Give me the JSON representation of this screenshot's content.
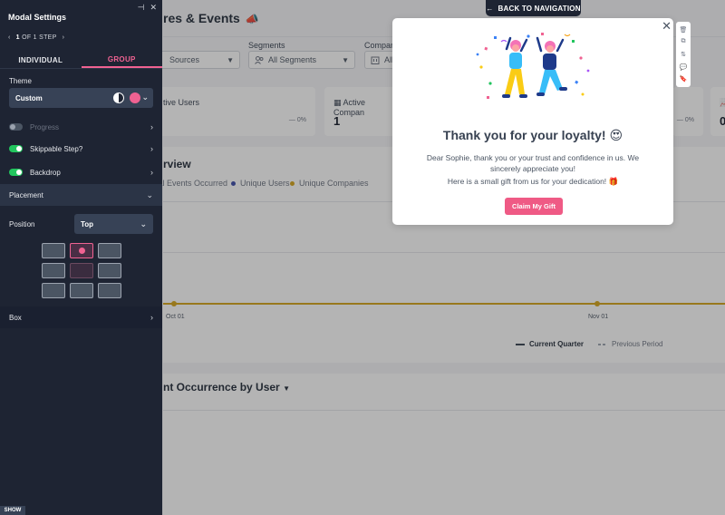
{
  "dashboard": {
    "title": "res & Events",
    "filters": [
      {
        "label": "",
        "value": "Sources"
      },
      {
        "label": "Segments",
        "value": "All Segments"
      },
      {
        "label": "Company",
        "value": "All"
      }
    ],
    "cards": [
      {
        "label": "tive Users",
        "value": "",
        "pct": "0%"
      },
      {
        "label": "Active Compan",
        "value": "1",
        "pct": ""
      },
      {
        "label": "",
        "value": "",
        "pct": "0%"
      },
      {
        "label": "",
        "value": "0",
        "pct": ""
      }
    ],
    "overview": {
      "title": "rview",
      "legend": [
        {
          "label": "tal Events Occurred",
          "color": "#c7c7d0"
        },
        {
          "label": "Unique Users",
          "color": "#3b4aa8"
        },
        {
          "label": "Unique Companies",
          "color": "#d4a417"
        }
      ],
      "bottom_legend": {
        "current": "Current Quarter",
        "previous": "Previous Period"
      }
    },
    "chart_data": {
      "type": "line",
      "x": [
        "Oct 01",
        "Nov 01"
      ],
      "series": [
        {
          "name": "Unique Companies",
          "values": [
            0,
            0
          ]
        }
      ]
    },
    "occurrence": {
      "title": "nt Occurrence by User"
    }
  },
  "back_nav": {
    "label": "BACK TO NAVIGATION"
  },
  "panel": {
    "title": "Modal Settings",
    "step": {
      "current": "1",
      "rest": "OF 1 STEP"
    },
    "tabs": [
      "INDIVIDUAL",
      "GROUP"
    ],
    "theme": {
      "label": "Theme",
      "value": "Custom"
    },
    "rows": {
      "progress": "Progress",
      "skippable": "Skippable Step?",
      "backdrop": "Backdrop",
      "placement": "Placement",
      "box": "Box"
    },
    "position": {
      "label": "Position",
      "value": "Top"
    },
    "show": "SHOW"
  },
  "modal": {
    "title": "Thank you for your loyalty! 😍",
    "body1": "Dear Sophie, thank you or your trust and confidence in us. We sincerely appreciate you!",
    "body2": "Here is a small gift from us for your dedication! 🎁",
    "cta": "Claim My Gift"
  },
  "colors": {
    "accent": "#f06292",
    "cta": "#ef5a85",
    "panel_bg": "#1e2433",
    "toggle_on": "#22c55e"
  }
}
